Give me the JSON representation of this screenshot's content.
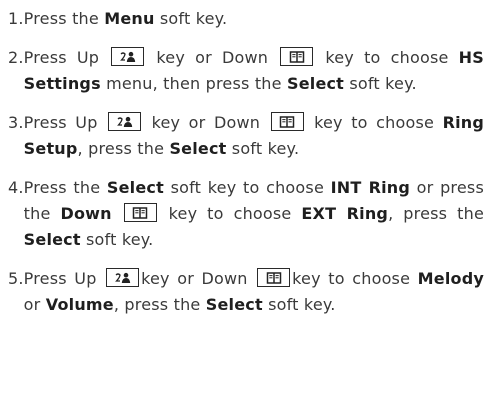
{
  "steps": [
    {
      "num": "1.",
      "parts": [
        {
          "t": "text",
          "v": "Press the "
        },
        {
          "t": "bold",
          "v": "Menu"
        },
        {
          "t": "text",
          "v": " soft key."
        }
      ]
    },
    {
      "num": "2.",
      "parts": [
        {
          "t": "text",
          "v": "Press Up "
        },
        {
          "t": "key",
          "v": "up"
        },
        {
          "t": "text",
          "v": " key or Down "
        },
        {
          "t": "key",
          "v": "down"
        },
        {
          "t": "text",
          "v": " key to choose "
        },
        {
          "t": "bold",
          "v": "HS Settings"
        },
        {
          "t": "text",
          "v": " menu, then press the "
        },
        {
          "t": "bold",
          "v": "Select"
        },
        {
          "t": "text",
          "v": " soft key."
        }
      ]
    },
    {
      "num": "3.",
      "parts": [
        {
          "t": "text",
          "v": "Press Up "
        },
        {
          "t": "key",
          "v": "up"
        },
        {
          "t": "text",
          "v": " key or Down "
        },
        {
          "t": "key",
          "v": "down"
        },
        {
          "t": "text",
          "v": " key to choose "
        },
        {
          "t": "bold",
          "v": "Ring Setup"
        },
        {
          "t": "text",
          "v": ", press the "
        },
        {
          "t": "bold",
          "v": "Select"
        },
        {
          "t": "text",
          "v": " soft key."
        }
      ]
    },
    {
      "num": "4.",
      "parts": [
        {
          "t": "text",
          "v": "Press the "
        },
        {
          "t": "bold",
          "v": "Select"
        },
        {
          "t": "text",
          "v": " soft key to choose "
        },
        {
          "t": "bold",
          "v": "INT Ring"
        },
        {
          "t": "text",
          "v": " or press the "
        },
        {
          "t": "bold",
          "v": "Down"
        },
        {
          "t": "text",
          "v": " "
        },
        {
          "t": "key",
          "v": "down"
        },
        {
          "t": "text",
          "v": " key to choose "
        },
        {
          "t": "bold",
          "v": "EXT Ring"
        },
        {
          "t": "text",
          "v": ", press the "
        },
        {
          "t": "bold",
          "v": "Select"
        },
        {
          "t": "text",
          "v": " soft key."
        }
      ]
    },
    {
      "num": "5.",
      "parts": [
        {
          "t": "text",
          "v": "Press Up "
        },
        {
          "t": "key",
          "v": "up"
        },
        {
          "t": "text",
          "v": "key or Down "
        },
        {
          "t": "key",
          "v": "down"
        },
        {
          "t": "text",
          "v": "key to choose "
        },
        {
          "t": "bold",
          "v": "Melody"
        },
        {
          "t": "text",
          "v": " or "
        },
        {
          "t": "bold",
          "v": "Volume"
        },
        {
          "t": "text",
          "v": ", press the "
        },
        {
          "t": "bold",
          "v": "Select"
        },
        {
          "t": "text",
          "v": " soft key."
        }
      ]
    }
  ],
  "icons": {
    "up": "contacts-key-icon",
    "down": "phonebook-key-icon"
  }
}
